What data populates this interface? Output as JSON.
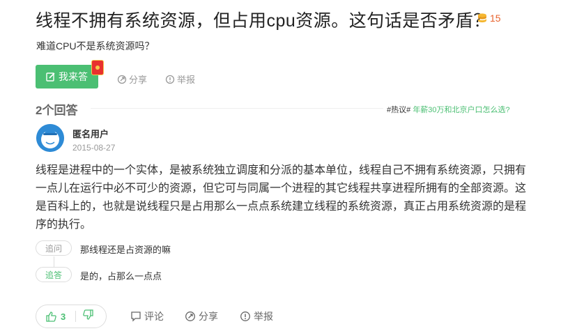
{
  "question": {
    "title": "线程不拥有系统资源，但占用cpu资源。这句话是否矛盾？",
    "reward": "15",
    "description": "难道CPU不是系统资源吗？"
  },
  "actions": {
    "answer_label": "我来答",
    "share_label": "分享",
    "report_label": "举报"
  },
  "answers_header": {
    "count_label": "2个回答",
    "hot_tag": "#热议#",
    "hot_link": "年薪30万和北京户口怎么选?"
  },
  "answer": {
    "user_name": "匿名用户",
    "date": "2015-08-27",
    "body": "线程是进程中的一个实体，是被系统独立调度和分派的基本单位，线程自己不拥有系统资源，只拥有一点儿在运行中必不可少的资源，但它可与同属一个进程的其它线程共享进程所拥有的全部资源。这是百科上的，也就是说线程只是占用那么一点点系统建立线程的系统资源，真正占用系统资源的是程序的执行。",
    "followups": [
      {
        "tag": "追问",
        "text": "那线程还是占资源的嘛"
      },
      {
        "tag": "追答",
        "text": "是的，占那么一点点"
      }
    ],
    "upvotes": "3",
    "comment_label": "评论",
    "share_label": "分享",
    "report_label": "举报"
  },
  "colors": {
    "accent_green": "#4bbf73",
    "reward_orange": "#e8632e",
    "muted_gray": "#999999"
  }
}
